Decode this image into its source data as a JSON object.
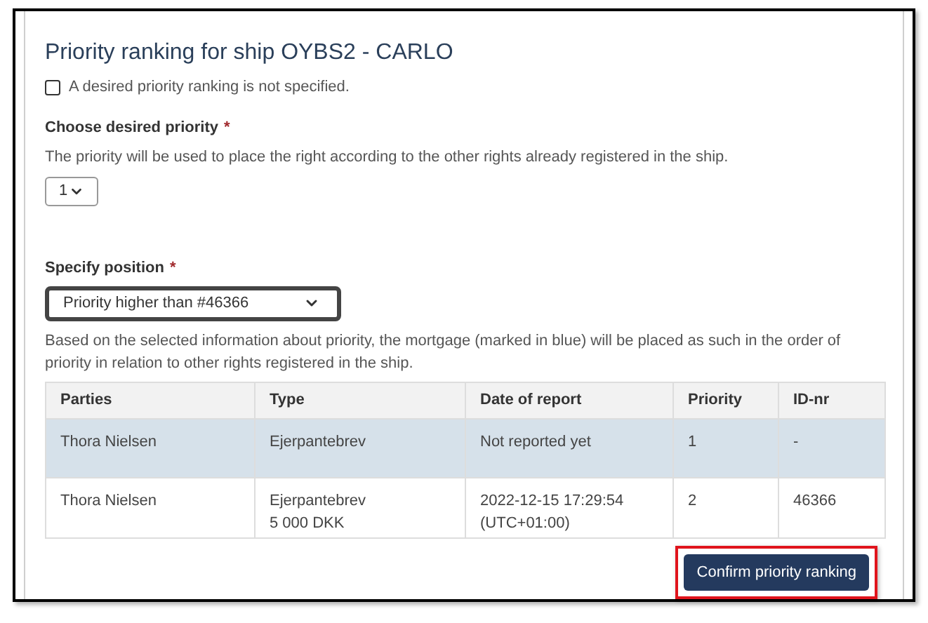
{
  "title": "Priority ranking for ship OYBS2 - CARLO",
  "unspecified_checkbox": {
    "label": "A desired priority ranking is not specified.",
    "checked": false
  },
  "priority_field": {
    "label": "Choose desired priority",
    "required_mark": "*",
    "hint": "The priority will be used to place the right according to the other rights already registered in the ship.",
    "value": "1"
  },
  "position_field": {
    "label": "Specify position",
    "required_mark": "*",
    "value": "Priority higher than #46366",
    "focused": true
  },
  "description": "Based on the selected information about priority, the mortgage (marked in blue) will be placed as such in the order of priority in relation to other rights registered in the ship.",
  "table": {
    "columns": [
      "Parties",
      "Type",
      "Date of report",
      "Priority",
      "ID-nr"
    ],
    "rows": [
      {
        "selected": true,
        "cells": [
          [
            "Thora Nielsen"
          ],
          [
            "Ejerpantebrev"
          ],
          [
            "Not reported yet"
          ],
          [
            "1"
          ],
          [
            "-"
          ]
        ]
      },
      {
        "selected": false,
        "cells": [
          [
            "Thora Nielsen"
          ],
          [
            "Ejerpantebrev",
            "5 000 DKK"
          ],
          [
            "2022-12-15 17:29:54",
            "(UTC+01:00)"
          ],
          [
            "2"
          ],
          [
            "46366"
          ]
        ]
      }
    ]
  },
  "confirm_button": {
    "label": "Confirm priority ranking",
    "highlighted": true
  }
}
